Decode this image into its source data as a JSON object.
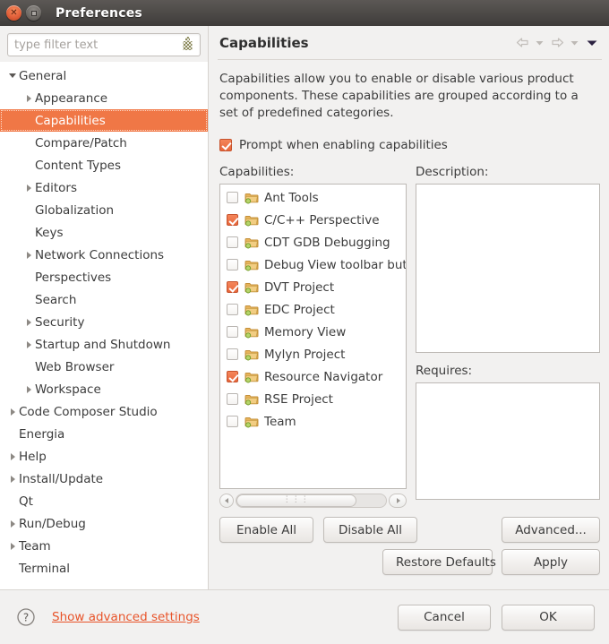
{
  "window": {
    "title": "Preferences",
    "close_icon": "close-icon",
    "maximize_icon": "maximize-icon"
  },
  "sidebar": {
    "filter": {
      "value": "",
      "placeholder": "type filter text",
      "clear_icon": "clear-filter-icon"
    },
    "items": [
      {
        "label": "General",
        "indent": 0,
        "twisty": "open",
        "selected": false
      },
      {
        "label": "Appearance",
        "indent": 1,
        "twisty": "closed",
        "selected": false
      },
      {
        "label": "Capabilities",
        "indent": 1,
        "twisty": "none",
        "selected": true
      },
      {
        "label": "Compare/Patch",
        "indent": 1,
        "twisty": "none",
        "selected": false
      },
      {
        "label": "Content Types",
        "indent": 1,
        "twisty": "none",
        "selected": false
      },
      {
        "label": "Editors",
        "indent": 1,
        "twisty": "closed",
        "selected": false
      },
      {
        "label": "Globalization",
        "indent": 1,
        "twisty": "none",
        "selected": false
      },
      {
        "label": "Keys",
        "indent": 1,
        "twisty": "none",
        "selected": false
      },
      {
        "label": "Network Connections",
        "indent": 1,
        "twisty": "closed",
        "selected": false
      },
      {
        "label": "Perspectives",
        "indent": 1,
        "twisty": "none",
        "selected": false
      },
      {
        "label": "Search",
        "indent": 1,
        "twisty": "none",
        "selected": false
      },
      {
        "label": "Security",
        "indent": 1,
        "twisty": "closed",
        "selected": false
      },
      {
        "label": "Startup and Shutdown",
        "indent": 1,
        "twisty": "closed",
        "selected": false
      },
      {
        "label": "Web Browser",
        "indent": 1,
        "twisty": "none",
        "selected": false
      },
      {
        "label": "Workspace",
        "indent": 1,
        "twisty": "closed",
        "selected": false
      },
      {
        "label": "Code Composer Studio",
        "indent": 0,
        "twisty": "closed",
        "selected": false
      },
      {
        "label": "Energia",
        "indent": 0,
        "twisty": "none",
        "selected": false
      },
      {
        "label": "Help",
        "indent": 0,
        "twisty": "closed",
        "selected": false
      },
      {
        "label": "Install/Update",
        "indent": 0,
        "twisty": "closed",
        "selected": false
      },
      {
        "label": "Qt",
        "indent": 0,
        "twisty": "none",
        "selected": false
      },
      {
        "label": "Run/Debug",
        "indent": 0,
        "twisty": "closed",
        "selected": false
      },
      {
        "label": "Team",
        "indent": 0,
        "twisty": "closed",
        "selected": false
      },
      {
        "label": "Terminal",
        "indent": 0,
        "twisty": "none",
        "selected": false
      }
    ]
  },
  "page": {
    "title": "Capabilities",
    "description": "Capabilities allow you to enable or disable various product components. These capabilities are grouped according to a set of predefined categories.",
    "nav": {
      "back_icon": "back-arrow-icon",
      "back_menu_icon": "chevron-down-icon",
      "forward_icon": "forward-arrow-icon",
      "forward_menu_icon": "chevron-down-icon",
      "menu_icon": "view-menu-icon"
    },
    "prompt": {
      "label": "Prompt when enabling capabilities",
      "checked": true
    },
    "capabilities_label": "Capabilities:",
    "description_label": "Description:",
    "requires_label": "Requires:",
    "description_value": "",
    "requires_value": "",
    "capabilities": [
      {
        "label": "Ant Tools",
        "checked": false
      },
      {
        "label": "C/C++ Perspective",
        "checked": true
      },
      {
        "label": "CDT GDB Debugging",
        "checked": false
      },
      {
        "label": "Debug View toolbar butt",
        "checked": false
      },
      {
        "label": "DVT Project",
        "checked": true
      },
      {
        "label": "EDC Project",
        "checked": false
      },
      {
        "label": "Memory View",
        "checked": false
      },
      {
        "label": "Mylyn Project",
        "checked": false
      },
      {
        "label": "Resource Navigator",
        "checked": true
      },
      {
        "label": "RSE Project",
        "checked": false
      },
      {
        "label": "Team",
        "checked": false
      }
    ],
    "buttons": {
      "enable_all": "Enable All",
      "disable_all": "Disable All",
      "advanced": "Advanced...",
      "restore_defaults": "Restore Defaults",
      "apply": "Apply"
    }
  },
  "footer": {
    "help_icon": "help-icon",
    "advanced_link": "Show advanced settings",
    "cancel": "Cancel",
    "ok": "OK"
  },
  "colors": {
    "accent": "#f07746",
    "link": "#e8542a",
    "checkbox_checked": "#e8673b",
    "titlebar": "#443f3c",
    "surface": "#f2f1f0"
  }
}
